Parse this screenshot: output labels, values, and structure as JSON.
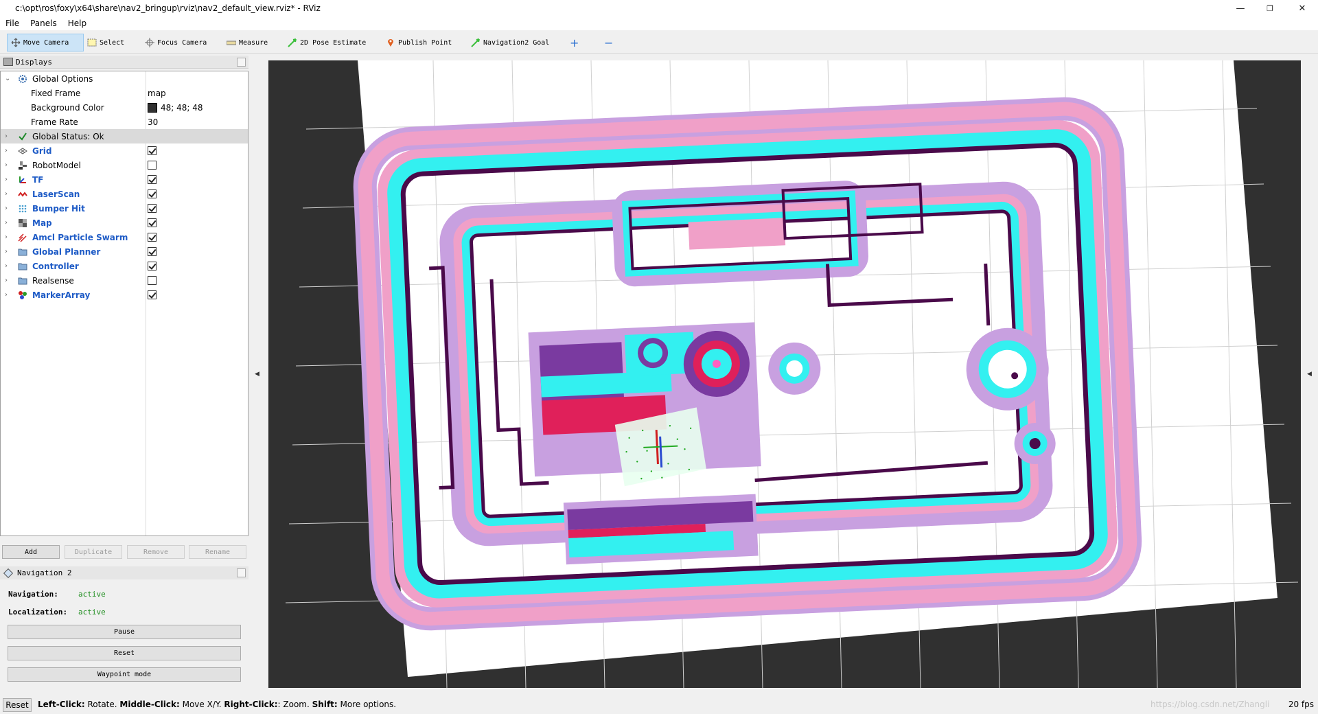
{
  "window": {
    "title": "c:\\opt\\ros\\foxy\\x64\\share\\nav2_bringup\\rviz\\nav2_default_view.rviz* - RViz",
    "minimize": "—",
    "maximize": "❐",
    "close": "✕"
  },
  "menu": {
    "file": "File",
    "panels": "Panels",
    "help": "Help"
  },
  "toolbar": {
    "move_camera": "Move Camera",
    "select": "Select",
    "focus_camera": "Focus Camera",
    "measure": "Measure",
    "pose_estimate": "2D Pose Estimate",
    "publish_point": "Publish Point",
    "nav_goal": "Navigation2 Goal",
    "plus": "+",
    "minus": "−"
  },
  "displays": {
    "header": "Displays",
    "global_options": "Global Options",
    "fixed_frame_label": "Fixed Frame",
    "fixed_frame_value": "map",
    "bg_color_label": "Background Color",
    "bg_color_value": "48; 48; 48",
    "frame_rate_label": "Frame Rate",
    "frame_rate_value": "30",
    "global_status": "Global Status: Ok",
    "items": [
      {
        "label": "Grid",
        "checked": true,
        "blue": true,
        "icon": "grid-icon"
      },
      {
        "label": "RobotModel",
        "checked": false,
        "blue": false,
        "icon": "robot-model-icon"
      },
      {
        "label": "TF",
        "checked": true,
        "blue": true,
        "icon": "tf-icon"
      },
      {
        "label": "LaserScan",
        "checked": true,
        "blue": true,
        "icon": "laser-scan-icon"
      },
      {
        "label": "Bumper Hit",
        "checked": true,
        "blue": true,
        "icon": "bumper-hit-icon"
      },
      {
        "label": "Map",
        "checked": true,
        "blue": true,
        "icon": "map-icon"
      },
      {
        "label": "Amcl Particle Swarm",
        "checked": true,
        "blue": true,
        "icon": "particle-swarm-icon"
      },
      {
        "label": "Global Planner",
        "checked": true,
        "blue": true,
        "icon": "folder-icon"
      },
      {
        "label": "Controller",
        "checked": true,
        "blue": true,
        "icon": "folder-icon"
      },
      {
        "label": "Realsense",
        "checked": false,
        "blue": false,
        "icon": "folder-icon"
      },
      {
        "label": "MarkerArray",
        "checked": true,
        "blue": true,
        "icon": "marker-array-icon"
      }
    ],
    "add": "Add",
    "duplicate": "Duplicate",
    "remove": "Remove",
    "rename": "Rename"
  },
  "nav2": {
    "header": "Navigation 2",
    "navigation_label": "Navigation:",
    "navigation_value": "active",
    "localization_label": "Localization:",
    "localization_value": "active",
    "pause": "Pause",
    "reset": "Reset",
    "waypoint": "Waypoint mode"
  },
  "status": {
    "reset": "Reset",
    "left_click": "Left-Click:",
    "left_click_desc": " Rotate. ",
    "middle_click": "Middle-Click:",
    "middle_click_desc": " Move X/Y. ",
    "right_click": "Right-Click:",
    "right_click_desc": ": Zoom. ",
    "shift": "Shift:",
    "shift_desc": " More options.",
    "watermark": "https://blog.csdn.net/Zhangli",
    "fps": "20 fps"
  },
  "colors": {
    "view_background": "#303030",
    "map_free": "#ffffff",
    "wall": "#4a0a4a",
    "inflation_cyan": "#33f0f0",
    "inflation_pink": "#f0a0c8",
    "inflation_lilac": "#c8a0e0",
    "costmap_red": "#e0205a",
    "costmap_purple": "#7a3aa0",
    "accent_blue": "#1e5bc6",
    "active_green": "#1c8c1c"
  }
}
